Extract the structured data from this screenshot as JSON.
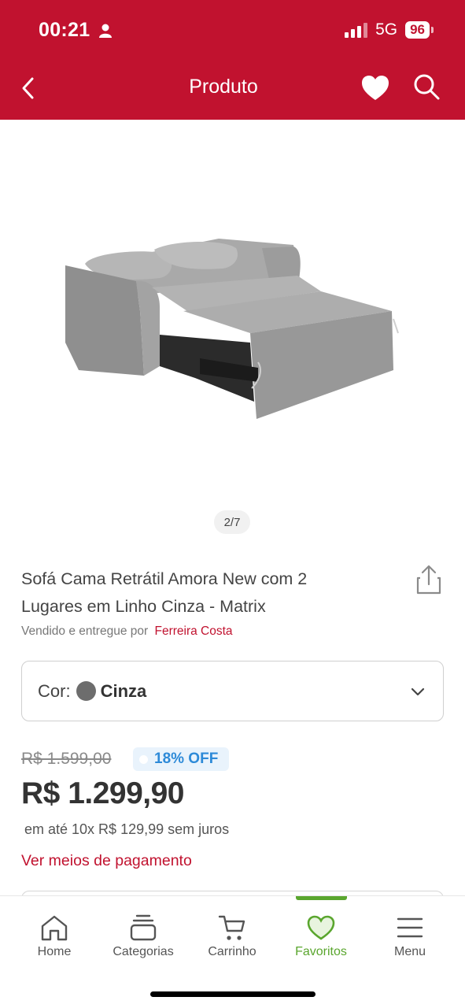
{
  "status_bar": {
    "time": "00:21",
    "network": "5G",
    "battery": "96"
  },
  "header": {
    "title": "Produto",
    "back_icon": "chevron-left-icon",
    "favorite_icon": "heart-icon",
    "search_icon": "search-icon"
  },
  "gallery": {
    "pager": "2/7"
  },
  "product": {
    "title": "Sofá Cama Retrátil Amora New com 2 Lugares em Linho Cinza - Matrix",
    "seller_prefix": "Vendido e entregue por",
    "seller_name": "Ferreira Costa"
  },
  "color_selector": {
    "label": "Cor:",
    "value": "Cinza",
    "swatch_color": "#6d6d6d"
  },
  "pricing": {
    "old_price": "R$ 1.599,00",
    "discount": "18% OFF",
    "price": "R$ 1.299,90",
    "installments": "em até 10x R$ 129,99 sem juros",
    "payment_link": "Ver meios de pagamento"
  },
  "tabbar": {
    "items": [
      {
        "label": "Home",
        "icon": "home-icon"
      },
      {
        "label": "Categorias",
        "icon": "categories-icon"
      },
      {
        "label": "Carrinho",
        "icon": "cart-icon"
      },
      {
        "label": "Favoritos",
        "icon": "heart-icon",
        "active": true
      },
      {
        "label": "Menu",
        "icon": "menu-icon"
      }
    ]
  },
  "colors": {
    "brand_red": "#c1122f",
    "active_green": "#5aa62e",
    "discount_blue": "#2d8ad8"
  }
}
